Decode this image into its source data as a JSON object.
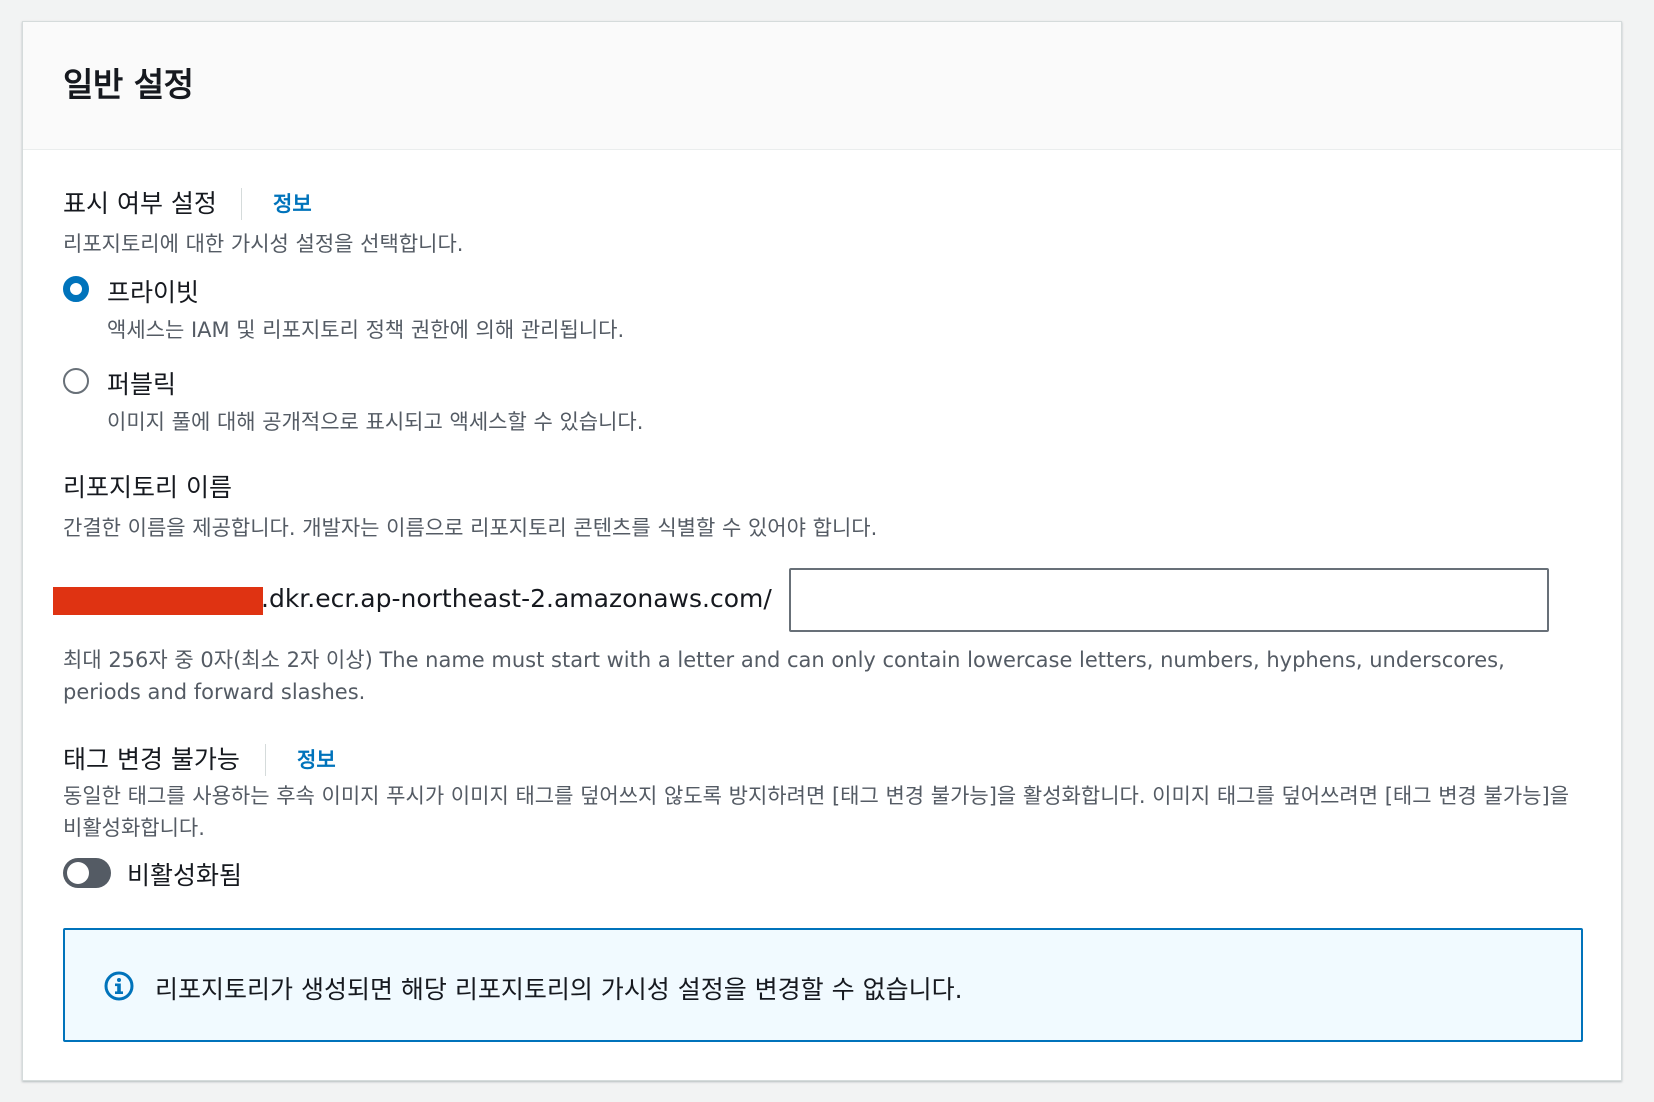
{
  "panel": {
    "title": "일반 설정"
  },
  "visibility": {
    "label": "표시 여부 설정",
    "info_link": "정보",
    "description": "리포지토리에 대한 가시성 설정을 선택합니다.",
    "options": [
      {
        "label": "프라이빗",
        "description": "액세스는 IAM 및 리포지토리 정책 권한에 의해 관리됩니다.",
        "selected": true
      },
      {
        "label": "퍼블릭",
        "description": "이미지 풀에 대해 공개적으로 표시되고 액세스할 수 있습니다.",
        "selected": false
      }
    ]
  },
  "repository_name": {
    "label": "리포지토리 이름",
    "description": "간결한 이름을 제공합니다. 개발자는 이름으로 리포지토리 콘텐츠를 식별할 수 있어야 합니다.",
    "uri_suffix": ".dkr.ecr.ap-northeast-2.amazonaws.com/",
    "value": "",
    "constraint": "최대 256자 중 0자(최소 2자 이상) The name must start with a letter and can only contain lowercase letters, numbers, hyphens, underscores, periods and forward slashes."
  },
  "tag_immutability": {
    "label": "태그 변경 불가능",
    "info_link": "정보",
    "description": "동일한 태그를 사용하는 후속 이미지 푸시가 이미지 태그를 덮어쓰지 않도록 방지하려면 [태그 변경 불가능]을 활성화합니다. 이미지 태그를 덮어쓰려면 [태그 변경 불가능]을 비활성화합니다.",
    "toggle_label": "비활성화됨",
    "enabled": false
  },
  "alert": {
    "icon": "info-icon",
    "text": "리포지토리가 생성되면 해당 리포지토리의 가시성 설정을 변경할 수 없습니다."
  },
  "colors": {
    "accent": "#0073bb",
    "redaction": "#df3312",
    "alert_bg": "#f1faff"
  }
}
